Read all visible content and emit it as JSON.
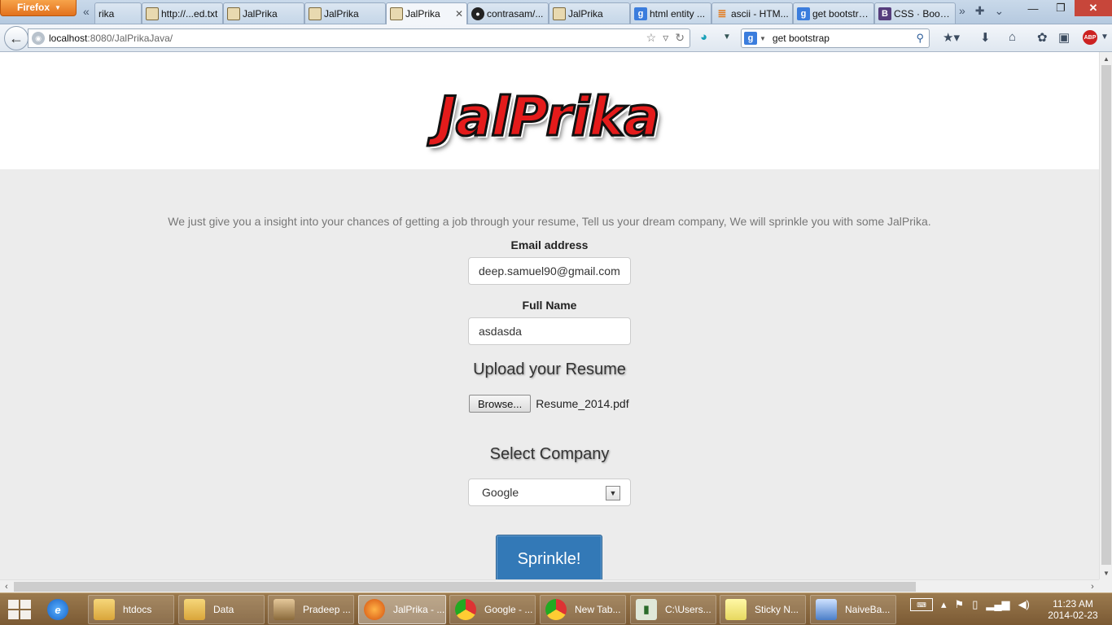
{
  "browser": {
    "menu_button": "Firefox",
    "tabs": [
      {
        "label": "rika",
        "icon": "image-icon"
      },
      {
        "label": "http://...ed.txt",
        "icon": "image-icon"
      },
      {
        "label": "JalPrika",
        "icon": "image-icon"
      },
      {
        "label": "JalPrika",
        "icon": "image-icon"
      },
      {
        "label": "JalPrika",
        "icon": "image-icon",
        "active": true
      },
      {
        "label": "contrasam/...",
        "icon": "github-icon"
      },
      {
        "label": "JalPrika",
        "icon": "image-icon"
      },
      {
        "label": "html entity ...",
        "icon": "google-icon"
      },
      {
        "label": "ascii - HTM...",
        "icon": "stackoverflow-icon"
      },
      {
        "label": "get bootstra...",
        "icon": "google-icon"
      },
      {
        "label": "CSS · Bootst...",
        "icon": "bootstrap-icon"
      }
    ],
    "url_host": "localhost",
    "url_path": ":8080/JalPrikaJava/",
    "search_text": "get bootstrap",
    "abp_label": "ABP"
  },
  "page": {
    "logo_text": "JalPrika",
    "tagline": "We just give you a insight into your chances of getting a job through your resume, Tell us your dream company, We will sprinkle you with some JalPrika.",
    "email_label": "Email address",
    "email_value": "deep.samuel90@gmail.com",
    "name_label": "Full Name",
    "name_value": "asdasda",
    "upload_heading": "Upload your Resume",
    "browse_label": "Browse...",
    "file_name": "Resume_2014.pdf",
    "company_heading": "Select Company",
    "company_selected": "Google",
    "submit_label": "Sprinkle!"
  },
  "taskbar": {
    "items": [
      {
        "label": "",
        "icon": "internet-explorer-icon"
      },
      {
        "label": "htdocs",
        "icon": "folder-icon"
      },
      {
        "label": "Data",
        "icon": "folder-icon"
      },
      {
        "label": "Pradeep ...",
        "icon": "user-folder-icon"
      },
      {
        "label": "JalPrika - ...",
        "icon": "firefox-icon",
        "active": true
      },
      {
        "label": "Google - ...",
        "icon": "chrome-icon"
      },
      {
        "label": "New Tab...",
        "icon": "chrome-icon"
      },
      {
        "label": "C:\\Users...",
        "icon": "command-prompt-icon"
      },
      {
        "label": "Sticky N...",
        "icon": "sticky-notes-icon"
      },
      {
        "label": "NaiveBa...",
        "icon": "virtualbox-icon"
      }
    ],
    "time": "11:23 AM",
    "date": "2014-02-23"
  }
}
